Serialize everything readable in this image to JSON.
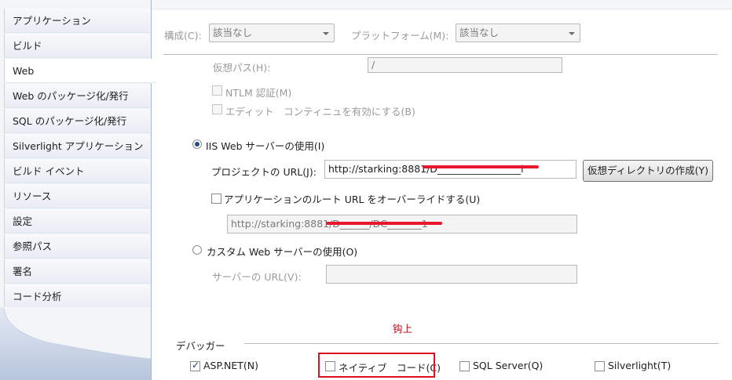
{
  "sidebar": {
    "items": [
      {
        "label": "アプリケーション"
      },
      {
        "label": "ビルド"
      },
      {
        "label": "Web"
      },
      {
        "label": "Web のパッケージ化/発行"
      },
      {
        "label": "SQL のパッケージ化/発行"
      },
      {
        "label": "Silverlight アプリケーション"
      },
      {
        "label": "ビルド イベント"
      },
      {
        "label": "リソース"
      },
      {
        "label": "設定"
      },
      {
        "label": "参照パス"
      },
      {
        "label": "署名"
      },
      {
        "label": "コード分析"
      }
    ]
  },
  "config": {
    "config_label": "構成(C):",
    "config_value": "該当なし",
    "platform_label": "プラットフォーム(M):",
    "platform_value": "該当なし"
  },
  "virtual_path": {
    "label": "仮想パス(H):",
    "value": "/"
  },
  "options": {
    "ntlm_label": "NTLM 認証(M)",
    "edit_continue_label": "エディット　コンティニュを有効にする(B)"
  },
  "iis": {
    "radio_label": "IIS Web サーバーの使用(I)",
    "project_url_label": "プロジェクトの URL(J):",
    "project_url_value": "http://starking:8881/D_________________l",
    "create_vdir_button": "仮想ディレクトリの作成(Y)",
    "override_label": "アプリケーションのルート URL をオーバーライドする(U)",
    "override_url_value": "http://starking:8881/D______/DC_______1"
  },
  "custom": {
    "radio_label": "カスタム Web サーバーの使用(O)",
    "server_url_label": "サーバーの URL(V):",
    "server_url_value": ""
  },
  "annotation": {
    "text": "钩上"
  },
  "debugger": {
    "section_label": "デバッガー",
    "aspnet_label": "ASP.NET(N)",
    "native_label": "ネイティブ　コード(C)",
    "sql_label": "SQL Server(Q)",
    "silverlight_label": "Silverlight(T)"
  },
  "colors": {
    "annotation_red": "#e01020",
    "sidebar_bg": "#f3f5f9"
  }
}
